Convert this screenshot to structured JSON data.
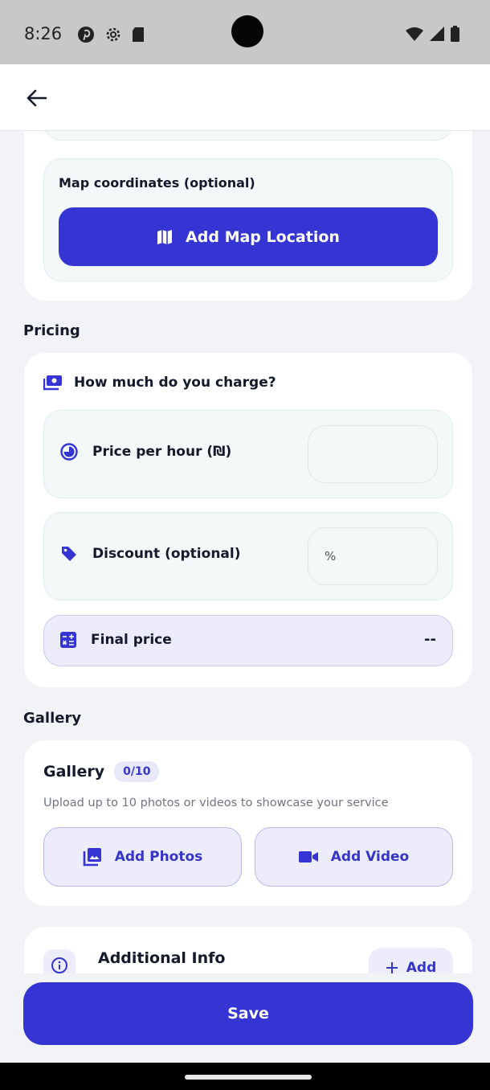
{
  "status_bar": {
    "time": "8:26"
  },
  "map": {
    "label": "Map coordinates (optional)",
    "button_label": "Add Map Location"
  },
  "pricing": {
    "section_title": "Pricing",
    "question": "How much do you charge?",
    "price_per_hour_label": "Price per hour (₪)",
    "price_per_hour_value": "",
    "discount_label": "Discount (optional)",
    "discount_placeholder": "%",
    "final_price_label": "Final price",
    "final_price_value": "--"
  },
  "gallery": {
    "section_title": "Gallery",
    "card_title": "Gallery",
    "count_badge": "0/10",
    "description": "Upload up to 10 photos or videos to showcase your service",
    "add_photos_label": "Add Photos",
    "add_video_label": "Add Video"
  },
  "additional_info": {
    "title": "Additional Info",
    "add_button_label": "Add"
  },
  "footer": {
    "save_label": "Save"
  },
  "colors": {
    "accent": "#3535d4",
    "accent_soft": "#ececfa",
    "inset_background": "#f3f8f8",
    "page_background": "#f1f3f6"
  }
}
